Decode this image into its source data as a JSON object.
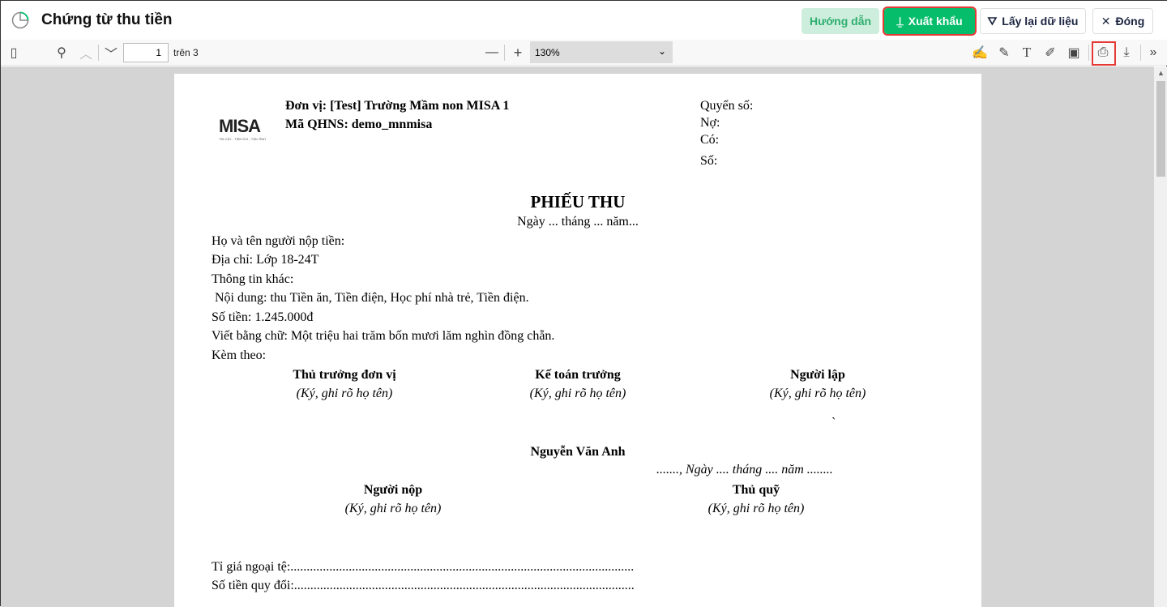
{
  "header": {
    "title": "Chứng từ thu tiền",
    "help": "Hướng dẫn",
    "export": "Xuất khẩu",
    "reload": "Lấy lại dữ liệu",
    "close": "Đóng"
  },
  "toolbar": {
    "page": "1",
    "of": "trên 3",
    "zoom": "130%"
  },
  "logo": {
    "brand": "MISA",
    "tagline": "TIN CẬY - TIỆN ÍCH - TẬN TÌNH"
  },
  "doc": {
    "unit": "Đơn vị: [Test] Trường Mầm non MISA 1",
    "code": "Mã QHNS: demo_mnmisa",
    "book": "Quyển số:",
    "debit": "Nợ:",
    "credit": "Có:",
    "number": "Số:",
    "title": "PHIẾU THU",
    "date": "Ngày ... tháng ... năm...",
    "payer": "Họ và tên người nộp tiền:",
    "address": "Địa chỉ: Lớp 18-24T",
    "other": "Thông tin khác:",
    "content": " Nội dung: thu Tiền ăn, Tiền điện, Học phí nhà trẻ, Tiền điện.",
    "amount": "Số tiền: 1.245.000đ",
    "words": "Viết bằng chữ: Một triệu hai trăm bốn mươi lăm nghìn đồng chẵn.",
    "attach": "Kèm theo:",
    "sig1": "Thủ trưởng đơn vị",
    "sig2": "Kế toán trưởng",
    "sig3": "Người lập",
    "sign_note": "(Ký, ghi rõ họ tên)",
    "mark": "`",
    "signer": "Nguyễn Văn Anh",
    "date2": "......., Ngày .... tháng .... năm ........",
    "sig4": "Người nộp",
    "sig5": "Thủ quỹ",
    "rate": "Tỉ giá ngoại tệ:..........................................................................................................",
    "converted": "Số tiền quy đổi:........................................................................................................."
  }
}
